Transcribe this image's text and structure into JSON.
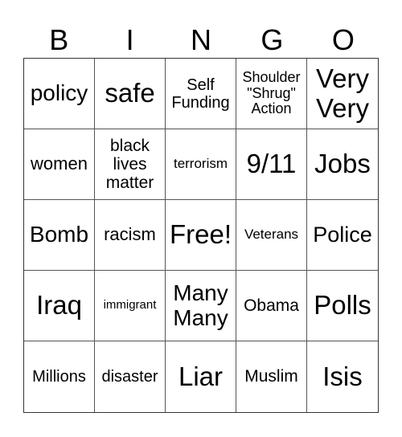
{
  "header": {
    "letters": [
      "B",
      "I",
      "N",
      "G",
      "O"
    ]
  },
  "cells": [
    [
      {
        "text": "policy",
        "size": 28
      },
      {
        "text": "safe",
        "size": 33
      },
      {
        "text": "Self\nFunding",
        "size": 20
      },
      {
        "text": "Shoulder\n\"Shrug\"\nAction",
        "size": 18
      },
      {
        "text": "Very\nVery",
        "size": 33
      }
    ],
    [
      {
        "text": "women",
        "size": 22
      },
      {
        "text": "black\nlives\nmatter",
        "size": 21
      },
      {
        "text": "terrorism",
        "size": 17
      },
      {
        "text": "9/11",
        "size": 33
      },
      {
        "text": "Jobs",
        "size": 33
      }
    ],
    [
      {
        "text": "Bomb",
        "size": 28
      },
      {
        "text": "racism",
        "size": 22
      },
      {
        "text": "Free!",
        "size": 33
      },
      {
        "text": "Veterans",
        "size": 17
      },
      {
        "text": "Police",
        "size": 27
      }
    ],
    [
      {
        "text": "Iraq",
        "size": 33
      },
      {
        "text": "immigrant",
        "size": 15
      },
      {
        "text": "Many\nMany",
        "size": 28
      },
      {
        "text": "Obama",
        "size": 21
      },
      {
        "text": "Polls",
        "size": 33
      }
    ],
    [
      {
        "text": "Millions",
        "size": 20
      },
      {
        "text": "disaster",
        "size": 20
      },
      {
        "text": "Liar",
        "size": 33
      },
      {
        "text": "Muslim",
        "size": 21
      },
      {
        "text": "Isis",
        "size": 33
      }
    ]
  ]
}
